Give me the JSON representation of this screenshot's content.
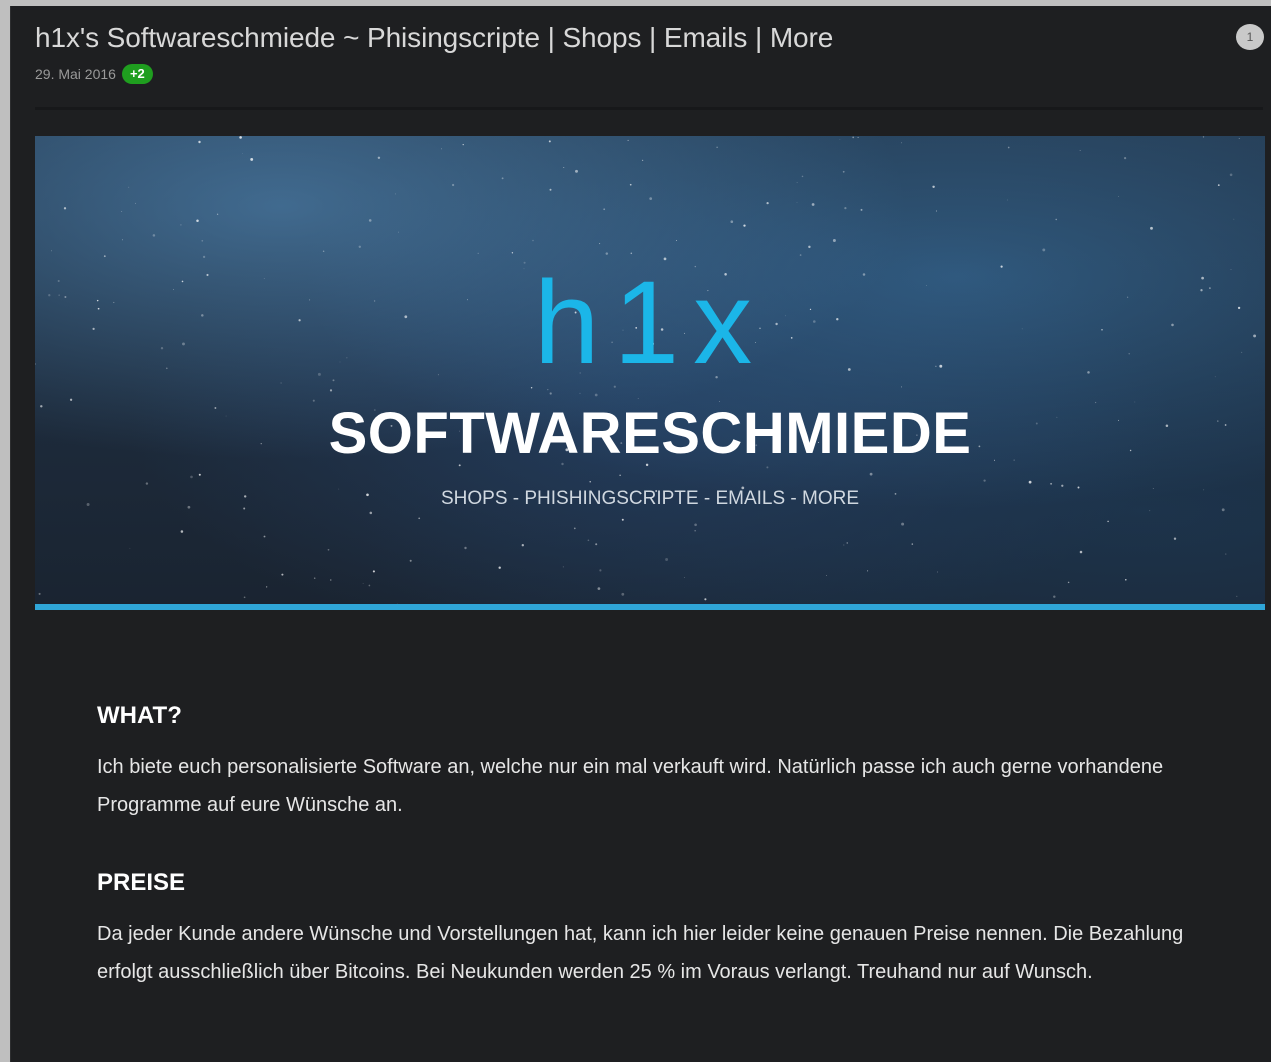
{
  "post": {
    "title": "h1x's Softwareschmiede ~ Phisingscripte | Shops | Emails | More",
    "date": "29. Mai 2016",
    "reputation": "+2",
    "post_number": "1"
  },
  "banner": {
    "logo_mark": "h1x",
    "logo_name": "SOFTWARESCHMIEDE",
    "tagline": "SHOPS - PHISHINGSCRIPTE - EMAILS - MORE",
    "accent_color": "#2fa6d8",
    "logo_color": "#1bb6e8"
  },
  "sections": [
    {
      "heading": "WHAT?",
      "text": "Ich biete euch personalisierte Software an, welche nur ein mal verkauft wird. Natürlich passe ich auch gerne vorhandene Programme auf eure Wünsche an."
    },
    {
      "heading": "PREISE",
      "text": "Da jeder Kunde andere Wünsche und Vorstellungen hat, kann ich hier leider keine genauen Preise nennen. Die Bezahlung erfolgt ausschließlich über Bitcoins. Bei Neukunden werden 25 % im Voraus verlangt. Treuhand nur auf Wunsch."
    }
  ],
  "colors": {
    "page_background": "#1e1f21",
    "reputation_badge": "#1f9e1f"
  }
}
